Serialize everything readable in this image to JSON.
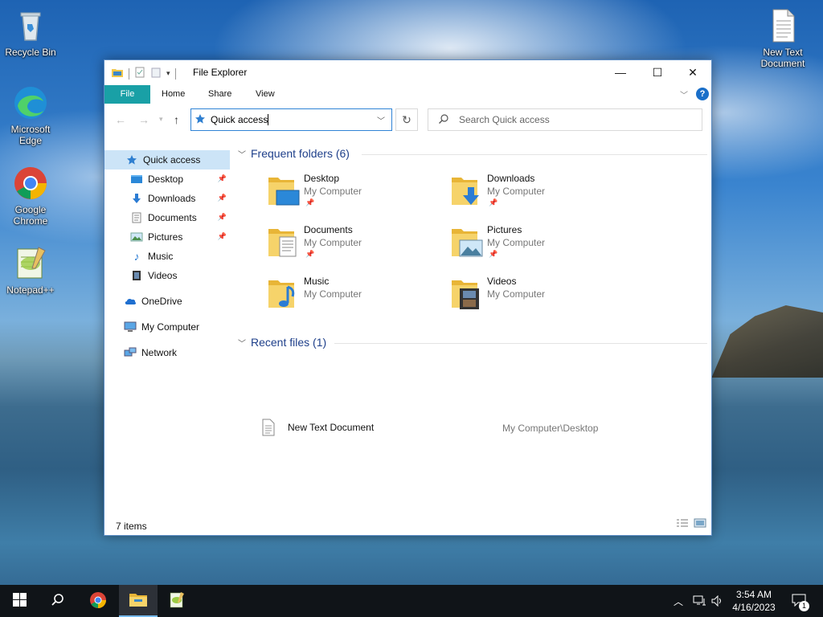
{
  "desktop": {
    "icons": [
      {
        "label": "Recycle Bin"
      },
      {
        "label": "Microsoft Edge"
      },
      {
        "label": "Google Chrome"
      },
      {
        "label": "Notepad++"
      },
      {
        "label": "New Text Document"
      }
    ]
  },
  "window": {
    "title": "File Explorer",
    "controls": {
      "minimize": "—",
      "maximize": "☐",
      "close": "✕"
    },
    "ribbon_tabs": [
      "File",
      "Home",
      "Share",
      "View"
    ],
    "address": "Quick access",
    "search_placeholder": "Search Quick access",
    "nav": {
      "quick_access": "Quick access",
      "items": [
        "Desktop",
        "Downloads",
        "Documents",
        "Pictures",
        "Music",
        "Videos"
      ],
      "onedrive": "OneDrive",
      "my_computer": "My Computer",
      "network": "Network"
    },
    "frequent": {
      "header": "Frequent folders (6)",
      "folders": [
        {
          "name": "Desktop",
          "location": "My Computer"
        },
        {
          "name": "Downloads",
          "location": "My Computer"
        },
        {
          "name": "Documents",
          "location": "My Computer"
        },
        {
          "name": "Pictures",
          "location": "My Computer"
        },
        {
          "name": "Music",
          "location": "My Computer"
        },
        {
          "name": "Videos",
          "location": "My Computer"
        }
      ]
    },
    "recent": {
      "header": "Recent files (1)",
      "files": [
        {
          "name": "New Text Document",
          "path": "My Computer\\Desktop"
        }
      ]
    },
    "status": "7 items"
  },
  "taskbar": {
    "time": "3:54 AM",
    "date": "4/16/2023",
    "notification_count": "1"
  },
  "colors": {
    "accent": "#19a0a6",
    "selection": "#cce4f7",
    "folder": "#f3c84b",
    "taskbar": "#101418"
  }
}
